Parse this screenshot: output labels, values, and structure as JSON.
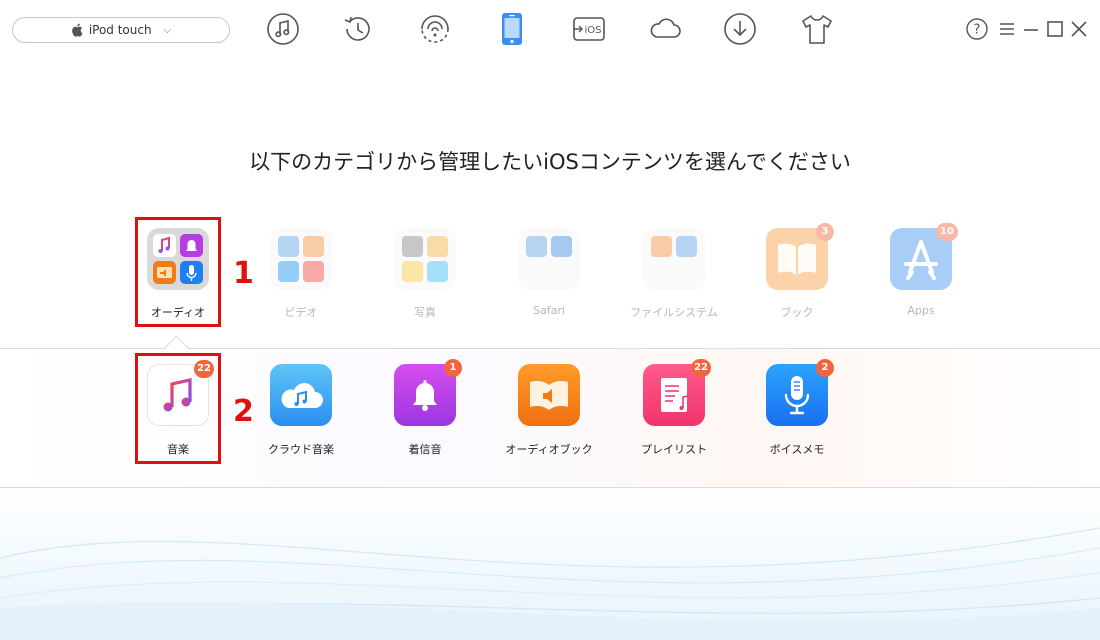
{
  "device": {
    "apple_icon": "apple-icon",
    "name": "iPod touch",
    "chevron": "chevron-down-icon"
  },
  "nav": [
    {
      "name": "music-note-icon"
    },
    {
      "name": "history-icon"
    },
    {
      "name": "wifi-sync-icon"
    },
    {
      "name": "device-manage-icon",
      "active": true
    },
    {
      "name": "ios-mover-icon",
      "text": "iOS"
    },
    {
      "name": "icloud-icon"
    },
    {
      "name": "download-icon"
    },
    {
      "name": "tshirt-icon"
    }
  ],
  "window": {
    "help": "help-icon",
    "menu": "menu-icon",
    "minimize": "minimize-icon",
    "maximize": "maximize-icon",
    "close": "close-icon"
  },
  "heading": "以下のカテゴリから管理したいiOSコンテンツを選んでください",
  "categories": [
    {
      "label": "オーディオ",
      "icon": "audio-folder-icon",
      "active": true
    },
    {
      "label": "ビデオ",
      "icon": "video-folder-icon"
    },
    {
      "label": "写真",
      "icon": "photo-folder-icon"
    },
    {
      "label": "Safari",
      "icon": "safari-folder-icon"
    },
    {
      "label": "ファイルシステム",
      "icon": "file-system-icon"
    },
    {
      "label": "ブック",
      "icon": "book-icon",
      "badge": "3"
    },
    {
      "label": "Apps",
      "icon": "app-store-icon",
      "badge": "10"
    }
  ],
  "audio_items": [
    {
      "label": "音楽",
      "icon": "music-icon",
      "badge": "22"
    },
    {
      "label": "クラウド音楽",
      "icon": "cloud-music-icon"
    },
    {
      "label": "着信音",
      "icon": "ringtone-bell-icon",
      "badge": "1"
    },
    {
      "label": "オーディオブック",
      "icon": "audiobook-icon"
    },
    {
      "label": "プレイリスト",
      "icon": "playlist-icon",
      "badge": "22"
    },
    {
      "label": "ボイスメモ",
      "icon": "voice-memo-icon",
      "badge": "2"
    }
  ],
  "annotations": {
    "step1": "1",
    "step2": "2"
  },
  "colors": {
    "accent_red": "#e01010",
    "badge": "#f1663c"
  }
}
